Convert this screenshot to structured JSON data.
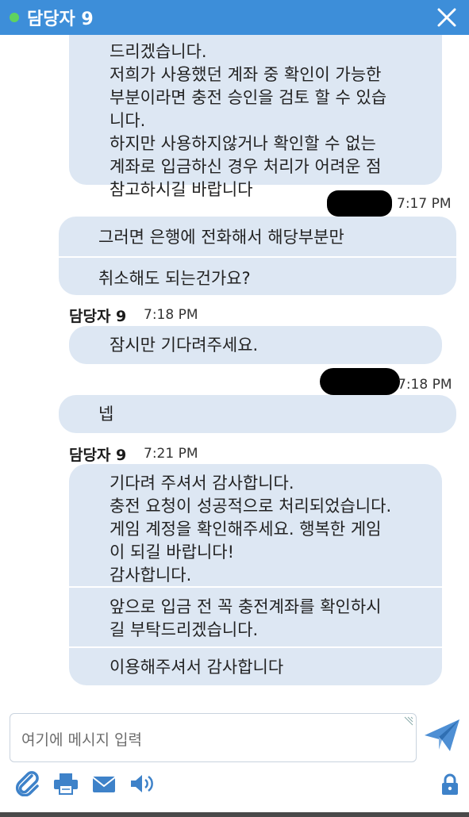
{
  "header": {
    "title": "담당자 9",
    "status_color": "#5fd35f",
    "bg_color": "#3d8ed9",
    "close_icon": "close-icon"
  },
  "messages": [
    {
      "from": "agent",
      "segments": [
        [
          "드리겠습니다.",
          "저희가 사용했던 계좌 중 확인이 가능한",
          "부분이라면 충전 승인을 검토 할 수 있습",
          "니다.",
          "하지만 사용하지않거나 확인할 수 없는",
          "계좌로 입금하신 경우 처리가 어려운 점",
          "참고하시길 바랍니다"
        ]
      ]
    },
    {
      "from": "user",
      "time": "7:17 PM",
      "segments": [
        [
          "그러면 은행에 전화해서 해당부분만"
        ],
        [
          "취소해도 되는건가요?"
        ]
      ]
    },
    {
      "from": "agent",
      "sender": "담당자 9",
      "time": "7:18 PM",
      "segments": [
        [
          "잠시만 기다려주세요."
        ]
      ]
    },
    {
      "from": "user",
      "time": "7:18 PM",
      "segments": [
        [
          "넵"
        ]
      ]
    },
    {
      "from": "agent",
      "sender": "담당자 9",
      "time": "7:21 PM",
      "segments": [
        [
          "기다려 주셔서 감사합니다.",
          "충전 요청이 성공적으로 처리되었습니다.",
          "게임 계정을 확인해주세요. 행복한 게임",
          "이 되길 바랍니다!",
          "감사합니다."
        ],
        [
          "앞으로 입금 전 꼭 충전계좌를 확인하시",
          "길 부탁드리겠습니다."
        ],
        [
          "이용해주셔서 감사합니다"
        ]
      ]
    }
  ],
  "composer": {
    "placeholder": "여기에 메시지 입력"
  },
  "toolbar": {
    "icons": [
      "attach-icon",
      "print-icon",
      "email-icon",
      "sound-icon"
    ],
    "lock_icon": "lock-icon",
    "send_icon": "send-icon"
  },
  "colors": {
    "bubble": "#dde7f3",
    "accent": "#3d8ed9"
  }
}
